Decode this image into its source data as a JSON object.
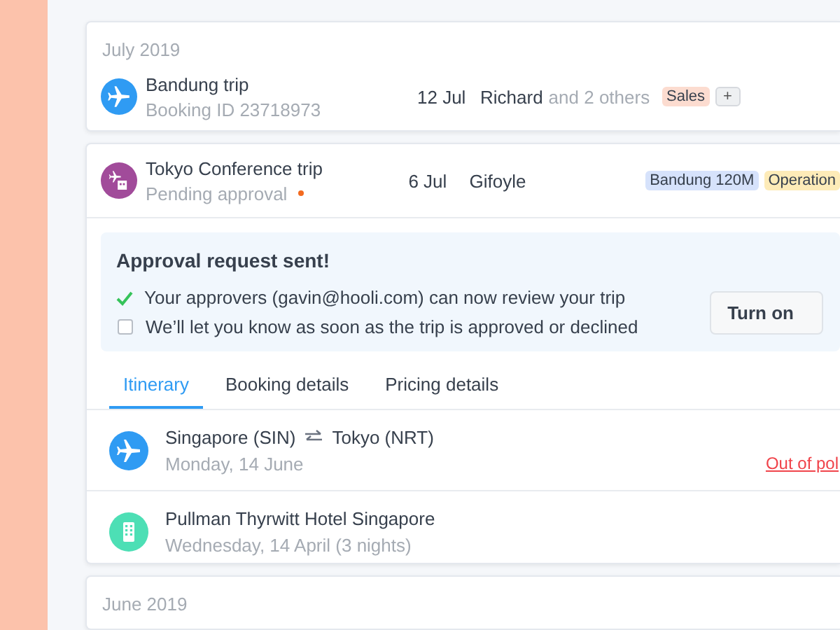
{
  "groups": [
    {
      "month": "July 2019",
      "trips": [
        {
          "kind": "flight",
          "title": "Bandung trip",
          "subtitle": "Booking ID 23718973",
          "pending": false,
          "date": "12 Jul",
          "person": "Richard",
          "others": "and 2 others",
          "tags": [
            {
              "label": "Sales",
              "color": "#fcdcd0"
            }
          ],
          "add_tag": "+"
        }
      ]
    }
  ],
  "expanded_trip": {
    "kind": "trip",
    "title": "Tokyo Conference trip",
    "subtitle": "Pending approval",
    "pending": true,
    "date": "6 Jul",
    "person": "Gifoyle",
    "tags": [
      {
        "label": "Bandung 120M",
        "color": "#d6e2fb"
      },
      {
        "label": "Operation",
        "color": "#fdebb8"
      }
    ],
    "approval": {
      "title": "Approval request sent!",
      "items": [
        {
          "text": "Your approvers (gavin@hooli.com) can now review your trip",
          "checked": true
        },
        {
          "text": "We’ll let you know as soon as the trip is approved or declined",
          "checked": false
        }
      ],
      "button": "Turn on"
    },
    "tabs": [
      {
        "label": "Itinerary",
        "selected": true
      },
      {
        "label": "Booking details",
        "selected": false
      },
      {
        "label": "Pricing details",
        "selected": false
      }
    ],
    "itinerary": [
      {
        "kind": "flight",
        "from": "Singapore (SIN)",
        "to": "Tokyo (NRT)",
        "date": "Monday, 14 June",
        "warning": "Out of pol"
      },
      {
        "kind": "hotel",
        "title": "Pullman Thyrwitt Hotel Singapore",
        "date": "Wednesday, 14 April (3 nights)"
      }
    ]
  },
  "next_group": {
    "month": "June 2019"
  }
}
